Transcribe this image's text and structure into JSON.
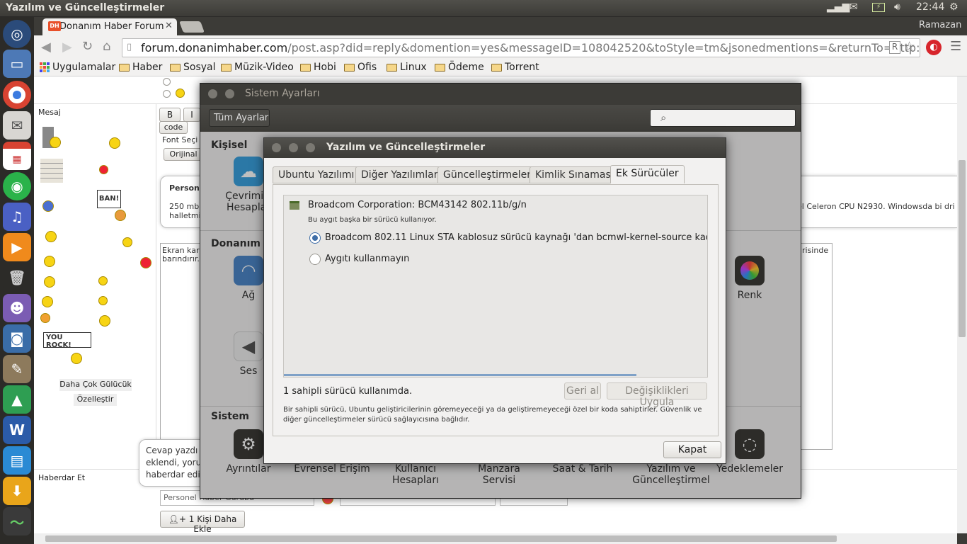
{
  "top_panel": {
    "window_title": "Yazılım ve Güncelleştirmeler",
    "time": "22:44",
    "user": "Ramazan"
  },
  "launcher": {
    "items": [
      "ubuntu-icon",
      "files-icon",
      "chrome-icon",
      "mail-icon",
      "calendar-icon",
      "whatsapp-icon",
      "music-icon",
      "vlc-icon",
      "trash-icon",
      "game-icon",
      "screenshot-icon",
      "gimp-icon",
      "drive-icon",
      "writer-icon",
      "calc-icon",
      "downloads-icon",
      "system-monitor-icon"
    ]
  },
  "browser": {
    "tab_title": "Donanım Haber Forum",
    "tab_icon_text": "DH",
    "url_host": "forum.donanimhaber.com",
    "url_rest": "/post.asp?did=reply&domention=yes&messageID=108042520&toStyle=tm&jsonedmentions=&returnTo=http://forum.dona",
    "bookmarks": [
      "Uygulamalar",
      "Haber",
      "Sosyal",
      "Müzik-Video",
      "Hobi",
      "Ofis",
      "Linux",
      "Ödeme",
      "Torrent"
    ]
  },
  "page": {
    "mesaj_label": "Mesaj",
    "btn_b": "B",
    "btn_i": "I",
    "btn_code": "code",
    "font_select": "Font Seçi",
    "original_btn": "Orijinal",
    "ban_sign": "BAN!",
    "rock_sign_left": "YOU",
    "rock_sign_right": "ROCK!",
    "more_smileys": "Daha Çok Gülücük",
    "customize": "Özelleştir",
    "tooltip1_title": "Person",
    "tooltip1_line1": "250 mb",
    "tooltip1_line2": "halletmi",
    "right_snippet": "el Celeron CPU N2930. Windowsda bi dri",
    "textarea_line1": "Ekran kar",
    "textarea_line2": "barındırır.",
    "textarea_right": "risinde",
    "tooltip2_line1": "Cevap yazdı",
    "tooltip2_line2": "eklendi, yoru",
    "tooltip2_line3": "haberdar edi",
    "haberdar_label": "Haberdar Et",
    "personel_input": "Personel Haber Gurubu",
    "add_person": "1 Kişi Daha Ekle"
  },
  "settings": {
    "title": "Sistem Ayarları",
    "all_settings": "Tüm Ayarlar",
    "sections": {
      "personal": "Kişisel",
      "hardware": "Donanım",
      "system": "Sistem"
    },
    "personal_items": [
      "Çevrimiçi Hesaplar"
    ],
    "hardware_items": [
      "Ağ",
      "Ses",
      "Renk"
    ],
    "system_items": [
      "Ayrıntılar",
      "Evrensel Erişim",
      "Kullanıcı Hesapları",
      "Manzara Servisi",
      "Saat & Tarih",
      "Yazılım ve Güncelleştirmel",
      "Yedeklemeler"
    ]
  },
  "dialog": {
    "title": "Yazılım ve Güncelleştirmeler",
    "tabs": [
      "Ubuntu Yazılımı",
      "Diğer Yazılımlar",
      "Güncelleştirmeler",
      "Kimlik Sınaması",
      "Ek Sürücüler"
    ],
    "active_tab": "Ek Sürücüler",
    "device_name": "Broadcom Corporation: BCM43142 802.11b/g/n",
    "device_note": "Bu aygıt başka bir sürücü kullanıyor.",
    "option_1": "Broadcom 802.11 Linux STA kablosuz sürücü kaynağı 'dan bcmwl-kernel-source kadarı k",
    "option_2": "Aygıtı kullanmayın",
    "selected_option": 1,
    "status": "1 sahipli sürücü kullanımda.",
    "revert_btn": "Geri al",
    "apply_btn": "Değişiklikleri Uygula",
    "info": "Bir sahipli sürücü, Ubuntu geliştiricilerinin göremeyeceği ya da geliştiremeyeceği özel bir koda sahiptirler. Güvenlik ve diğer güncelleştirmeler sürücü sağlayıcısına bağlıdır.",
    "close_btn": "Kapat"
  },
  "colors": {
    "panel": "#3c3b37",
    "accent": "#3f6ea8",
    "tab_icon": "#e8502a"
  }
}
